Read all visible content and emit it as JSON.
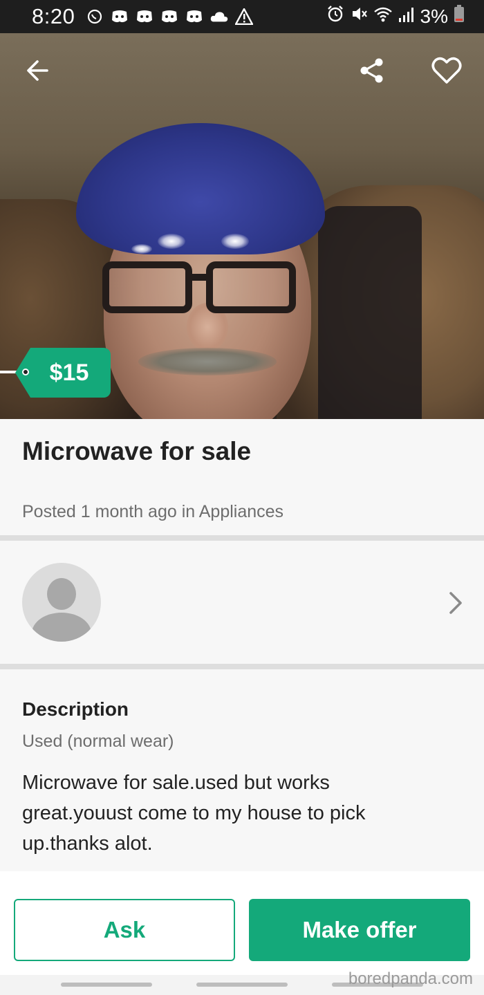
{
  "status_bar": {
    "time": "8:20",
    "notification_icons": [
      "whatsapp-icon",
      "discord-icon",
      "discord-icon",
      "discord-icon",
      "discord-icon",
      "cloud-icon",
      "warning-icon"
    ],
    "battery": "3%"
  },
  "listing": {
    "price": "$15",
    "title": "Microwave for sale",
    "posted": "Posted 1 month ago in Appliances"
  },
  "description": {
    "heading": "Description",
    "condition": "Used (normal wear)",
    "body": "Microwave for sale.used but works great.youust come to my house to pick up.thanks alot."
  },
  "actions": {
    "ask_label": "Ask",
    "offer_label": "Make offer"
  },
  "watermark": "boredpanda.com",
  "colors": {
    "accent": "#14a97a",
    "status_bar": "#1e1e1e"
  }
}
